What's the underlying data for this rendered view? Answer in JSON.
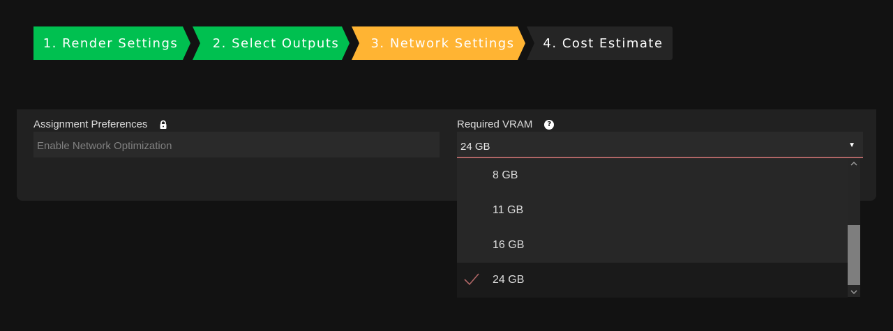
{
  "stepper": {
    "steps": [
      {
        "label": "1. Render Settings",
        "state": "done"
      },
      {
        "label": "2. Select Outputs",
        "state": "done"
      },
      {
        "label": "3. Network Settings",
        "state": "active"
      },
      {
        "label": "4. Cost Estimate",
        "state": "pending"
      }
    ],
    "colors": {
      "done": "#00c050",
      "active": "#ffb433",
      "pending": "#252525"
    }
  },
  "assignment": {
    "label": "Assignment Preferences",
    "icon": "lock-icon",
    "value": "Enable Network Optimization"
  },
  "vram": {
    "label": "Required VRAM",
    "icon": "help-icon",
    "help_glyph": "?",
    "selected": "24 GB",
    "options": [
      "8 GB",
      "11 GB",
      "16 GB",
      "24 GB"
    ],
    "selected_index": 3,
    "accent_color": "#b06666"
  }
}
